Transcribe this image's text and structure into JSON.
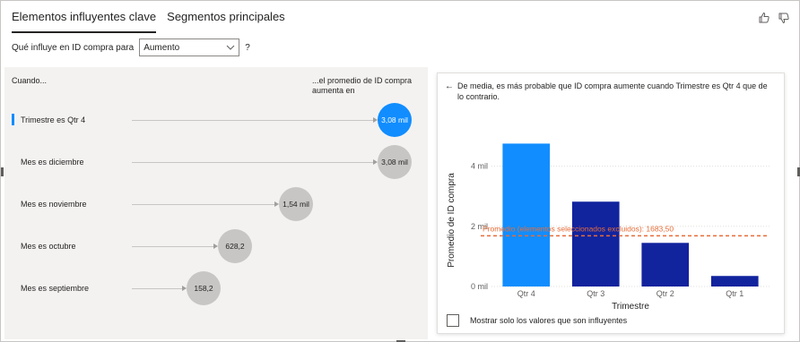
{
  "tabs": [
    {
      "label": "Elementos influyentes clave",
      "active": true
    },
    {
      "label": "Segmentos principales",
      "active": false
    }
  ],
  "icons": {
    "thumbs_up": "thumbs-up-icon",
    "thumbs_down": "thumbs-down-icon",
    "back": "arrow-left-icon",
    "dropdown": "chevron-down-icon"
  },
  "param": {
    "label": "Qué influye en ID compra para",
    "selected": "Aumento",
    "help": "?"
  },
  "left": {
    "when_header": "Cuando...",
    "value_header": "...el promedio de ID compra aumenta en",
    "rows": [
      {
        "label": "Trimestre es Qtr 4",
        "value": "3,08 mil",
        "selected": true
      },
      {
        "label": "Mes es diciembre",
        "value": "3,08 mil",
        "selected": false
      },
      {
        "label": "Mes es noviembre",
        "value": "1,54 mil",
        "selected": false
      },
      {
        "label": "Mes es octubre",
        "value": "628,2",
        "selected": false
      },
      {
        "label": "Mes es septiembre",
        "value": "158,2",
        "selected": false
      }
    ]
  },
  "right": {
    "back_arrow": "←",
    "description": "De media, es más probable que ID compra aumente cuando Trimestre es Qtr 4 que de lo contrario.",
    "checkbox_label": "Mostrar solo los valores que son influyentes"
  },
  "colors": {
    "accent": "#118dff",
    "bar_dark": "#12239e",
    "reference": "#e66c37"
  },
  "chart_data": {
    "type": "bar",
    "categories": [
      "Qtr 4",
      "Qtr 3",
      "Qtr 2",
      "Qtr 1"
    ],
    "values": [
      4750,
      2820,
      1450,
      350
    ],
    "highlight_index": 0,
    "xlabel": "Trimestre",
    "ylabel": "Promedio de ID compra",
    "ylim": [
      0,
      5000
    ],
    "yticks": [
      0,
      2000,
      4000
    ],
    "ytick_labels": [
      "0 mil",
      "2 mil",
      "4 mil"
    ],
    "reference_line": {
      "value": 1683.5,
      "label": "Promedio (elementos seleccionados excluidos): 1683,50"
    },
    "grid": true
  }
}
